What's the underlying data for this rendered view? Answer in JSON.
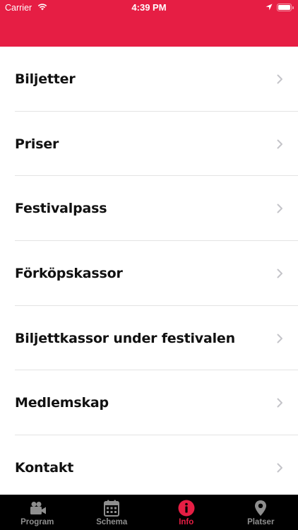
{
  "status_bar": {
    "carrier": "Carrier",
    "time": "4:39 PM"
  },
  "colors": {
    "accent": "#e61e44",
    "tabbar_bg": "#000000",
    "tab_inactive": "#8e8e8e"
  },
  "menu": {
    "items": [
      {
        "label": "Biljetter"
      },
      {
        "label": "Priser"
      },
      {
        "label": "Festivalpass"
      },
      {
        "label": "Förköpskassor"
      },
      {
        "label": "Biljettkassor under festivalen"
      },
      {
        "label": "Medlemskap"
      },
      {
        "label": "Kontakt"
      }
    ]
  },
  "tabbar": {
    "tabs": [
      {
        "label": "Program",
        "icon": "video-camera-icon"
      },
      {
        "label": "Schema",
        "icon": "calendar-icon"
      },
      {
        "label": "Info",
        "icon": "info-icon",
        "active": true
      },
      {
        "label": "Platser",
        "icon": "location-pin-icon"
      }
    ]
  }
}
